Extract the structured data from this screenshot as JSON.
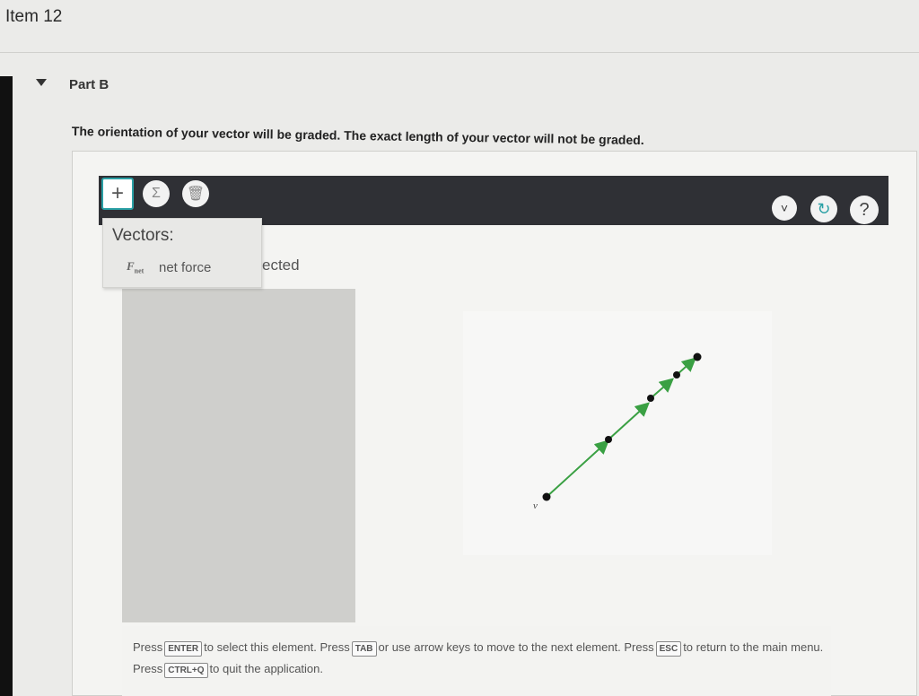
{
  "header": {
    "item_title": "Item 12"
  },
  "part": {
    "label": "Part B"
  },
  "instructions": "The orientation of your vector will be graded. The exact length of your vector will not be graded.",
  "toolbar": {
    "add_glyph": "+",
    "sum_glyph": "Σ",
    "delete_glyph": "🗑",
    "dropdown_glyph": "˅",
    "reset_glyph": "↻",
    "help_glyph": "?"
  },
  "vectors_panel": {
    "title": "Vectors:",
    "items": [
      {
        "symbol": "F",
        "subscript": "net",
        "name": "net force"
      }
    ]
  },
  "partial_text": "ected",
  "canvas": {
    "vector_label": "v"
  },
  "status": {
    "press1": "Press",
    "key_enter": "ENTER",
    "select_text": "to select this element. Press",
    "key_tab": "TAB",
    "move_text": "or use arrow keys to move to the next element. Press",
    "key_esc": "ESC",
    "return_text": "to return to the main menu. Press",
    "key_ctrlq": "CTRL+Q",
    "quit_text": "to quit the application."
  },
  "colors": {
    "vector_green": "#3aa043",
    "toolbar_bg": "#2f3035",
    "accent": "#2aa0a5"
  }
}
